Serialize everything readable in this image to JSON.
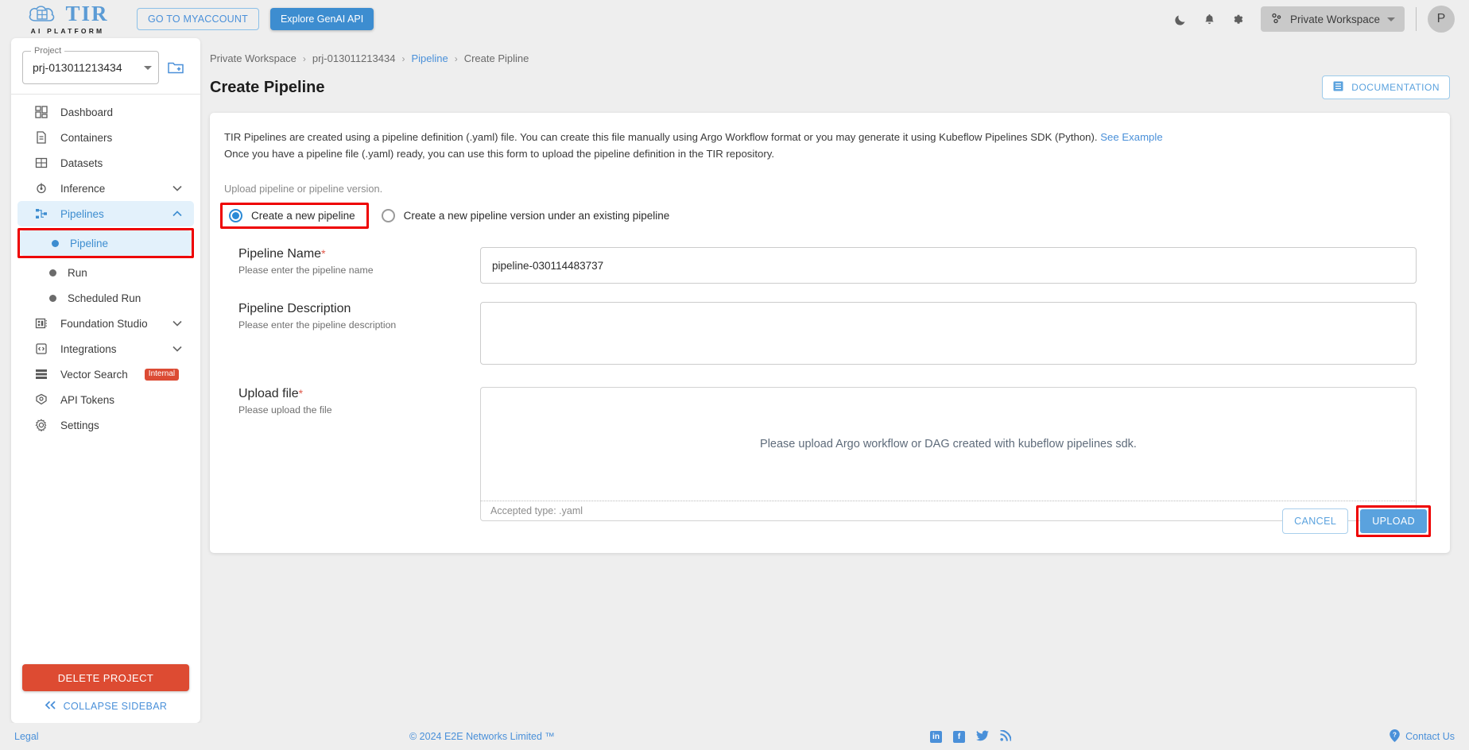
{
  "topbar": {
    "logo_text": "TIR",
    "logo_sub": "AI PLATFORM",
    "myaccount_label": "GO TO MYACCOUNT",
    "genai_label": "Explore GenAI API",
    "workspace_label": "Private Workspace",
    "avatar_initial": "P",
    "icons": [
      "moon-icon",
      "bell-icon",
      "gear-icon"
    ]
  },
  "sidebar": {
    "project_legend": "Project",
    "project_value": "prj-013011213434",
    "items": [
      {
        "label": "Dashboard",
        "icon": "dashboard-icon",
        "expandable": false
      },
      {
        "label": "Containers",
        "icon": "document-icon",
        "expandable": false
      },
      {
        "label": "Datasets",
        "icon": "grid-icon",
        "expandable": false
      },
      {
        "label": "Inference",
        "icon": "inference-icon",
        "expandable": true
      },
      {
        "label": "Pipelines",
        "icon": "pipelines-icon",
        "expandable": true
      },
      {
        "label": "Foundation Studio",
        "icon": "studio-icon",
        "expandable": true
      },
      {
        "label": "Integrations",
        "icon": "integrations-icon",
        "expandable": true
      },
      {
        "label": "Vector Search",
        "icon": "vector-search-icon",
        "badge": "Internal"
      },
      {
        "label": "API Tokens",
        "icon": "token-icon",
        "expandable": false
      },
      {
        "label": "Settings",
        "icon": "settings-icon",
        "expandable": false
      }
    ],
    "pipelines_children": [
      {
        "label": "Pipeline",
        "current": true
      },
      {
        "label": "Run",
        "current": false
      },
      {
        "label": "Scheduled Run",
        "current": false
      }
    ],
    "delete_project_label": "DELETE PROJECT",
    "collapse_label": "COLLAPSE SIDEBAR"
  },
  "breadcrumb": [
    {
      "label": "Private Workspace",
      "link": false
    },
    {
      "label": "prj-013011213434",
      "link": false
    },
    {
      "label": "Pipeline",
      "link": true
    },
    {
      "label": "Create Pipline",
      "link": false
    }
  ],
  "page": {
    "title": "Create Pipeline",
    "documentation_label": "DOCUMENTATION"
  },
  "card": {
    "intro_line1_a": "TIR Pipelines are created using a pipeline definition (.yaml) file. You can create this file manually using Argo Workflow format or you may generate it using Kubeflow Pipelines SDK (Python).",
    "intro_link": "See Example",
    "intro_line2": "Once you have a pipeline file (.yaml) ready, you can use this form to upload the pipeline definition in the TIR repository.",
    "upload_note": "Upload pipeline or pipeline version.",
    "radio_option_1": "Create a new pipeline",
    "radio_option_2": "Create a new pipeline version under an existing pipeline",
    "fields": {
      "name_label": "Pipeline Name",
      "name_required": "*",
      "name_hint": "Please enter the pipeline name",
      "name_value": "pipeline-030114483737",
      "desc_label": "Pipeline Description",
      "desc_hint": "Please enter the pipeline description",
      "desc_value": "",
      "desc_placeholder": "",
      "upload_label": "Upload file",
      "upload_required": "*",
      "upload_hint": "Please upload the file",
      "drop_text": "Please upload Argo workflow or DAG created with kubeflow pipelines sdk.",
      "accepted_type": "Accepted type: .yaml"
    },
    "cancel_label": "CANCEL",
    "upload_label": "UPLOAD"
  },
  "footer": {
    "legal": "Legal",
    "copyright": "© 2024 E2E Networks Limited ™",
    "contact": "Contact Us",
    "social": [
      "linkedin-icon",
      "facebook-icon",
      "twitter-icon",
      "rss-icon"
    ]
  },
  "colors": {
    "accent": "#4a90d9",
    "danger": "#dd4b32",
    "annotation": "#ee0000",
    "active_bg": "#e3f1fb"
  }
}
